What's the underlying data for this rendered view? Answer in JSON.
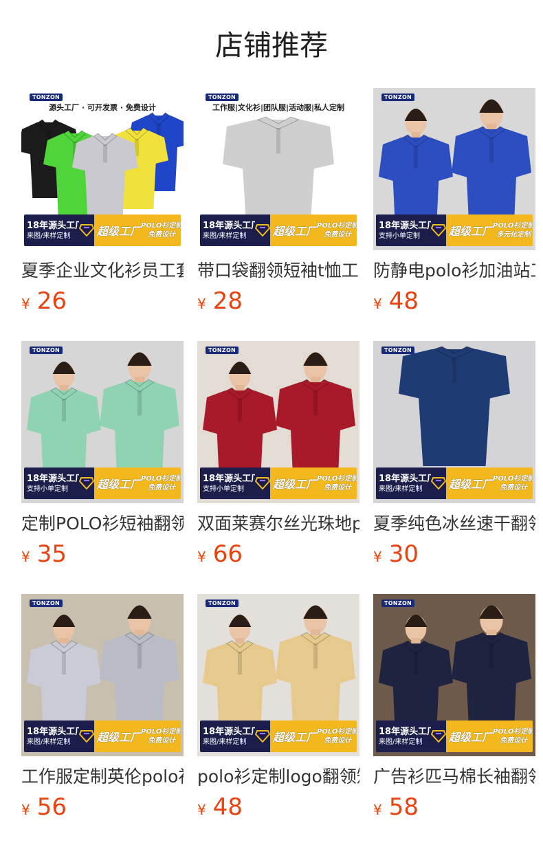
{
  "page": {
    "title": "店铺推荐"
  },
  "colors": {
    "price": "#e8420e",
    "banner_dark": "#1b1d4a",
    "banner_gold": "#f2b81d",
    "brand_badge": "#1a2a7a"
  },
  "products": [
    {
      "name": "夏季企业文化衫员工套装",
      "currency": "¥",
      "price": "26",
      "image": {
        "brand": "TONZON",
        "caption": "源头工厂 · 可开发票 · 免费设计",
        "banner_line1": "18年源头工厂",
        "banner_line2": "来图/来样定制",
        "banner_super": "超级工厂",
        "banner_polo1": "POLO衫定制",
        "banner_polo2": "免费设计",
        "shirts": [
          "#1f46c8",
          "#f0e23a",
          "#c9c9cf",
          "#4fd43a",
          "#1b1b1b"
        ],
        "bg": "#ffffff"
      }
    },
    {
      "name": "带口袋翻领短袖t恤工作服",
      "currency": "¥",
      "price": "28",
      "image": {
        "brand": "TONZON",
        "caption": "工作服|文化衫|团队服|活动服|私人定制",
        "banner_line1": "18年源头工厂",
        "banner_line2": "来图/来样定制",
        "banner_super": "超级工厂",
        "banner_polo1": "POLO衫定制",
        "banner_polo2": "免费设计",
        "shirts": [
          "#cfcfcf"
        ],
        "bg": "#ffffff"
      }
    },
    {
      "name": "防静电polo衫加油站工作服",
      "currency": "¥",
      "price": "48",
      "image": {
        "brand": "TONZON",
        "caption": "",
        "banner_line1": "18年源头工厂",
        "banner_line2": "支持小单定制",
        "banner_super": "超级工厂",
        "banner_polo1": "POLO衫定制",
        "banner_polo2": "多元化定制",
        "shirts": [
          "#2d4ec0",
          "#2d4ec0"
        ],
        "bg": "#d8d8d8"
      }
    },
    {
      "name": "定制POLO衫短袖翻领工作服",
      "currency": "¥",
      "price": "35",
      "image": {
        "brand": "TONZON",
        "caption": "",
        "banner_line1": "18年源头工厂",
        "banner_line2": "支持小单定制",
        "banner_super": "超级工厂",
        "banner_polo1": "POLO衫定制",
        "banner_polo2": "免费设计",
        "shirts": [
          "#8fd3b2",
          "#8fd3b2"
        ],
        "bg": "#d6d6d6"
      }
    },
    {
      "name": "双面莱赛尔丝光珠地polo衫",
      "currency": "¥",
      "price": "66",
      "image": {
        "brand": "TONZON",
        "caption": "",
        "banner_line1": "18年源头工厂",
        "banner_line2": "支持小单定制",
        "banner_super": "超级工厂",
        "banner_polo1": "POLO衫定制",
        "banner_polo2": "免费设计",
        "shirts": [
          "#a8192a",
          "#a8192a"
        ],
        "bg": "#e2dcd4"
      }
    },
    {
      "name": "夏季纯色冰丝速干翻领短袖",
      "currency": "¥",
      "price": "30",
      "image": {
        "brand": "TONZON",
        "caption": "",
        "banner_line1": "18年源头工厂",
        "banner_line2": "来图/来样定制",
        "banner_super": "超级工厂",
        "banner_polo1": "POLO衫定制",
        "banner_polo2": "免费设计",
        "shirts": [
          "#1f3b73"
        ],
        "bg": "#d4d4d6"
      }
    },
    {
      "name": "工作服定制英伦polo衫",
      "currency": "¥",
      "price": "56",
      "image": {
        "brand": "TONZON",
        "caption": "",
        "banner_line1": "18年源头工厂",
        "banner_line2": "来图/来样定制",
        "banner_super": "超级工厂",
        "banner_polo1": "POLO衫定制",
        "banner_polo2": "免费设计",
        "shirts": [
          "#c9cbd6",
          "#b9bcc6"
        ],
        "bg": "#c9bfae"
      }
    },
    {
      "name": "polo衫定制logo翻领短袖",
      "currency": "¥",
      "price": "48",
      "image": {
        "brand": "TONZON",
        "caption": "",
        "banner_line1": "18年源头工厂",
        "banner_line2": "来图/来样定制",
        "banner_super": "超级工厂",
        "banner_polo1": "POLO衫定制",
        "banner_polo2": "免费设计",
        "shirts": [
          "#e6c98c",
          "#e6c98c"
        ],
        "bg": "#e3e0dc"
      }
    },
    {
      "name": "广告衫匹马棉长袖翻领polo",
      "currency": "¥",
      "price": "58",
      "image": {
        "brand": "TONZON",
        "caption": "",
        "banner_line1": "18年源头工厂",
        "banner_line2": "来图/来样定制",
        "banner_super": "超级工厂",
        "banner_polo1": "POLO衫定制",
        "banner_polo2": "免费设计",
        "shirts": [
          "#1e2340",
          "#1e2340"
        ],
        "bg": "#6d5a4a"
      }
    }
  ]
}
